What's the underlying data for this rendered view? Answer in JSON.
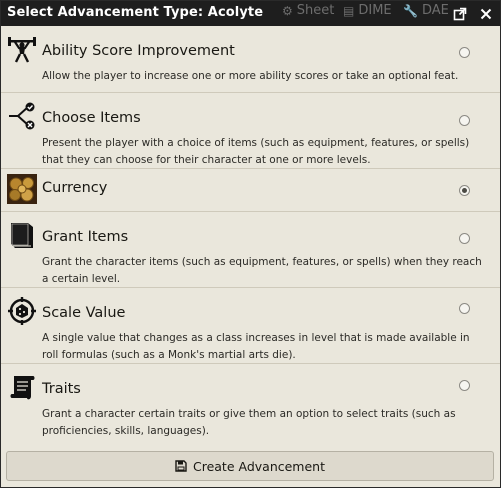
{
  "window": {
    "title": "Select Advancement Type: Acolyte",
    "background_tabs": [
      {
        "icon": "gear-icon",
        "label": "Sheet"
      },
      {
        "icon": "dime-icon",
        "label": "DIME"
      },
      {
        "icon": "wrench-icon",
        "label": "DAE"
      }
    ],
    "popout_icon": "popout-icon",
    "close_icon": "close-icon"
  },
  "advancements": [
    {
      "name": "Ability Score Improvement",
      "description": "Allow the player to increase one or more ability scores or take an optional feat.",
      "icon": "weightlifter-icon",
      "selected": false
    },
    {
      "name": "Choose Items",
      "description": "Present the player with a choice of items (such as equipment, features, or spells) that they can choose for their character at one or more levels.",
      "icon": "branching-choice-icon",
      "selected": false
    },
    {
      "name": "Currency",
      "description": "",
      "icon": "coins-icon",
      "selected": true
    },
    {
      "name": "Grant Items",
      "description": "Grant the character items (such as equipment, features, or spells) when they reach a certain level.",
      "icon": "book-icon",
      "selected": false
    },
    {
      "name": "Scale Value",
      "description": "A single value that changes as a class increases in level that is made available in roll formulas (such as a Monk's martial arts die).",
      "icon": "dice-target-icon",
      "selected": false
    },
    {
      "name": "Traits",
      "description": "Grant a character certain traits or give them an option to select traits (such as proficiencies, skills, languages).",
      "icon": "scroll-icon",
      "selected": false
    }
  ],
  "footer": {
    "button_label": "Create Advancement",
    "icon": "save-icon"
  },
  "colors": {
    "titlebar": "#1e1e1e",
    "panel": "#eae7dc",
    "text": "#191813",
    "divider": "#cfcabb"
  }
}
